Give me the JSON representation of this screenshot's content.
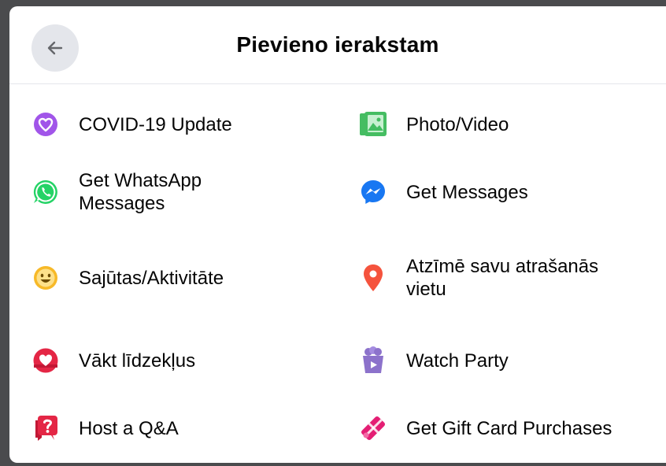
{
  "header": {
    "title": "Pievieno ierakstam",
    "back_icon": "arrow-left-icon"
  },
  "items": [
    {
      "label": "COVID-19 Update",
      "icon": "covid-heart-icon",
      "color": "#a155e9"
    },
    {
      "label": "Photo/Video",
      "icon": "photo-video-icon",
      "color": "#45bd62"
    },
    {
      "label": "Get WhatsApp Messages",
      "icon": "whatsapp-icon",
      "color": "#25d366"
    },
    {
      "label": "Get Messages",
      "icon": "messenger-icon",
      "color": "#1877f2"
    },
    {
      "label": "Sajūtas/Aktivitāte",
      "icon": "smiley-icon",
      "color": "#f7b928"
    },
    {
      "label": "Atzīmē savu atrašanās vietu",
      "icon": "location-pin-icon",
      "color": "#f5533d"
    },
    {
      "label": "Vākt līdzekļus",
      "icon": "fundraiser-heart-icon",
      "color": "#e42645"
    },
    {
      "label": "Watch Party",
      "icon": "watch-party-icon",
      "color": "#8c72cb"
    },
    {
      "label": "Host a Q&A",
      "icon": "qa-icon",
      "color": "#e42645"
    },
    {
      "label": "Get Gift Card Purchases",
      "icon": "gift-card-icon",
      "color": "#e41e74"
    }
  ]
}
